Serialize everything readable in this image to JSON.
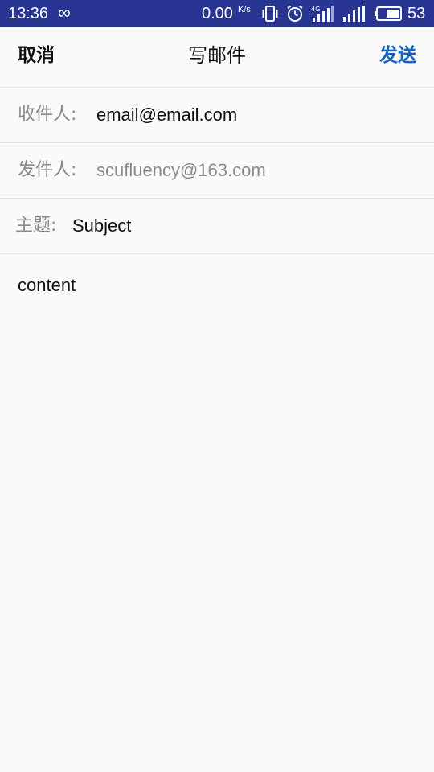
{
  "status_bar": {
    "time": "13:36",
    "network_speed": "0.00",
    "speed_unit": "K/s",
    "battery_level": "53",
    "icons": [
      "infinity-icon",
      "vibrate-icon",
      "alarm-icon",
      "4g-signal-icon",
      "signal-icon",
      "battery-icon"
    ]
  },
  "header": {
    "cancel_label": "取消",
    "title": "写邮件",
    "send_label": "发送"
  },
  "form": {
    "to_label": "收件人:",
    "to_value": "email@email.com",
    "from_label": "发件人:",
    "from_value": "scufluency@163.com",
    "subject_label": "主题:",
    "subject_value": "Subject"
  },
  "body": {
    "content": "content"
  },
  "colors": {
    "status_bar_bg": "#283593",
    "send_accent": "#1565c0",
    "background": "#fafafa",
    "divider": "#e2e2e2"
  }
}
